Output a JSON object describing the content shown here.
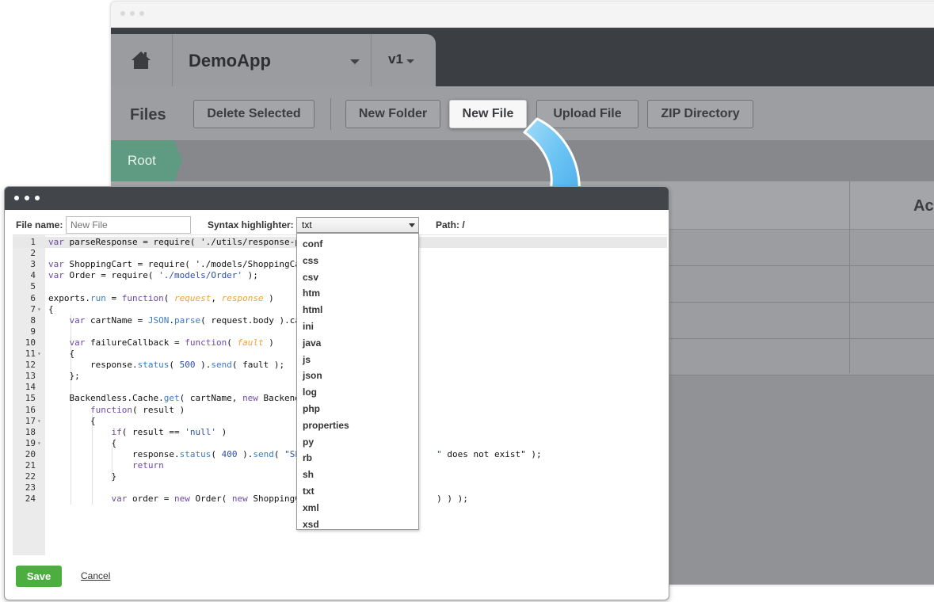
{
  "app": {
    "name": "DemoApp",
    "version": "v1"
  },
  "toolbar": {
    "section_label": "Files",
    "buttons": [
      "Delete Selected",
      "New Folder",
      "New File",
      "Upload File",
      "ZIP Directory"
    ]
  },
  "breadcrumb": {
    "root": "Root"
  },
  "grid": {
    "actions_header": "Ac"
  },
  "editor_dialog": {
    "file_name_label": "File name:",
    "file_name_placeholder": "New File",
    "syntax_label": "Syntax highlighter:",
    "syntax_selected": "txt",
    "path_label": "Path: /",
    "syntax_options": [
      "conf",
      "css",
      "csv",
      "htm",
      "html",
      "ini",
      "java",
      "js",
      "json",
      "log",
      "php",
      "properties",
      "py",
      "rb",
      "sh",
      "txt",
      "xml",
      "xsd"
    ],
    "save_label": "Save",
    "cancel_label": "Cancel"
  },
  "code_lines": [
    {
      "n": "1",
      "t": "var parseResponse = require( './utils/response-par"
    },
    {
      "n": "2",
      "t": ""
    },
    {
      "n": "3",
      "t": "var ShoppingCart = require( './models/ShoppingCart"
    },
    {
      "n": "4",
      "t": "var Order = require( './models/Order' );"
    },
    {
      "n": "5",
      "t": ""
    },
    {
      "n": "6",
      "t": "exports.run = function( request, response )"
    },
    {
      "n": "7",
      "t": "{"
    },
    {
      "n": "8",
      "t": "    var cartName = JSON.parse( request.body ).cart"
    },
    {
      "n": "9",
      "t": ""
    },
    {
      "n": "10",
      "t": "    var failureCallback = function( fault )"
    },
    {
      "n": "11",
      "t": "    {"
    },
    {
      "n": "12",
      "t": "        response.status( 500 ).send( fault );"
    },
    {
      "n": "13",
      "t": "    };"
    },
    {
      "n": "14",
      "t": ""
    },
    {
      "n": "15",
      "t": "    Backendless.Cache.get( cartName, new Backendle"
    },
    {
      "n": "16",
      "t": "        function( result )"
    },
    {
      "n": "17",
      "t": "        {"
    },
    {
      "n": "18",
      "t": "            if( result == 'null' )"
    },
    {
      "n": "19",
      "t": "            {"
    },
    {
      "n": "20",
      "t": "                response.status( 400 ).send( \"Shop                        \" does not exist\" );"
    },
    {
      "n": "21",
      "t": "                return"
    },
    {
      "n": "22",
      "t": "            }"
    },
    {
      "n": "23",
      "t": ""
    },
    {
      "n": "24",
      "t": "            var order = new Order( new ShoppingCar                        ) ) );"
    }
  ]
}
